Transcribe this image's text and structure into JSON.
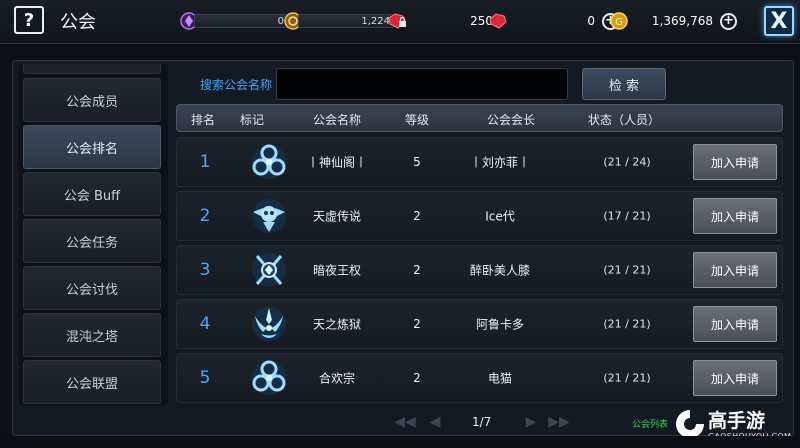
{
  "header": {
    "help_label": "?",
    "title": "公会",
    "close_label": "X"
  },
  "resources": [
    {
      "icon": "purple-gem-icon",
      "value": "0"
    },
    {
      "icon": "gold-medal-icon",
      "value": "1,224"
    },
    {
      "icon": "locked-ruby-icon",
      "value": "250"
    },
    {
      "icon": "ruby-icon",
      "value": "0"
    },
    {
      "icon": "gold-coin-icon",
      "value": "1,369,768"
    }
  ],
  "sidebar": {
    "items": [
      {
        "label": "公会成员",
        "active": false
      },
      {
        "label": "公会排名",
        "active": true
      },
      {
        "label": "公会 Buff",
        "active": false
      },
      {
        "label": "公会任务",
        "active": false
      },
      {
        "label": "公会讨伐",
        "active": false
      },
      {
        "label": "混沌之塔",
        "active": false
      },
      {
        "label": "公会联盟",
        "active": false
      }
    ]
  },
  "search": {
    "label": "搜索公会名称",
    "value": "",
    "placeholder": "",
    "button_label": "检 索"
  },
  "table": {
    "columns": [
      "排名",
      "标记",
      "公会名称",
      "等级",
      "公会会长",
      "状态（人员）"
    ],
    "join_label": "加入申请",
    "rows": [
      {
        "rank": "1",
        "emblem": "triskelion-emblem-icon",
        "name": "丨神仙阁丨",
        "level": "5",
        "leader": "丨刘亦菲丨",
        "status": "(21 / 24)"
      },
      {
        "rank": "2",
        "emblem": "winged-skull-emblem-icon",
        "name": "天虚传说",
        "level": "2",
        "leader": "Ice代",
        "status": "(17 / 21)"
      },
      {
        "rank": "3",
        "emblem": "crossed-swords-emblem-icon",
        "name": "暗夜王权",
        "level": "2",
        "leader": "醉卧美人膝",
        "status": "(21 / 21)"
      },
      {
        "rank": "4",
        "emblem": "feather-crown-emblem-icon",
        "name": "天之炼狱",
        "level": "2",
        "leader": "阿鲁卡多",
        "status": "(21 / 21)"
      },
      {
        "rank": "5",
        "emblem": "triskelion-emblem-icon",
        "name": "合欢宗",
        "level": "2",
        "leader": "电猫",
        "status": "(21 / 21)"
      }
    ]
  },
  "pager": {
    "page": "1/7",
    "note": "公会列表"
  },
  "watermark": {
    "text": "高手游",
    "sub": "GAOSHOUYOU.COM"
  }
}
